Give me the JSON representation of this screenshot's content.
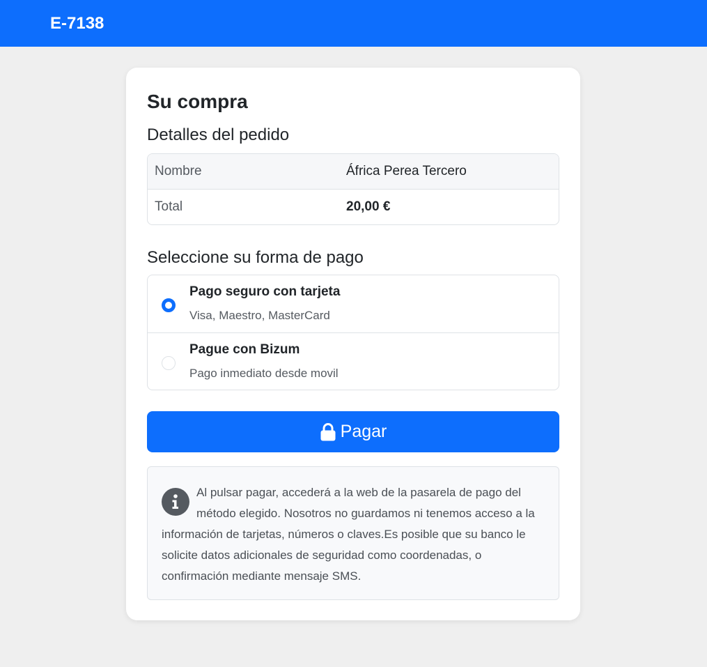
{
  "header": {
    "brand": "E-7138",
    "brand_color": "#0d6efd"
  },
  "purchase": {
    "title": "Su compra",
    "details_title": "Detalles del pedido",
    "details": [
      {
        "label": "Nombre",
        "value": "África Perea Tercero"
      },
      {
        "label": "Total",
        "value": "20,00 €"
      }
    ]
  },
  "payment": {
    "title": "Seleccione su forma de pago",
    "options": [
      {
        "name": "Pago seguro con tarjeta",
        "description": "Visa, Maestro, MasterCard",
        "selected": true
      },
      {
        "name": "Pague con Bizum",
        "description": "Pago inmediato desde movil",
        "selected": false
      }
    ],
    "button_label": "Pagar",
    "button_icon": "lock-icon"
  },
  "info": {
    "icon": "info-icon",
    "text": "Al pulsar pagar, accederá a la web de la pasarela de pago del método elegido. Nosotros no guardamos ni tenemos acceso a la información de tarjetas, números o claves.Es posible que su banco le solicite datos adicionales de seguridad como coordenadas, o confirmación mediante mensaje SMS."
  }
}
